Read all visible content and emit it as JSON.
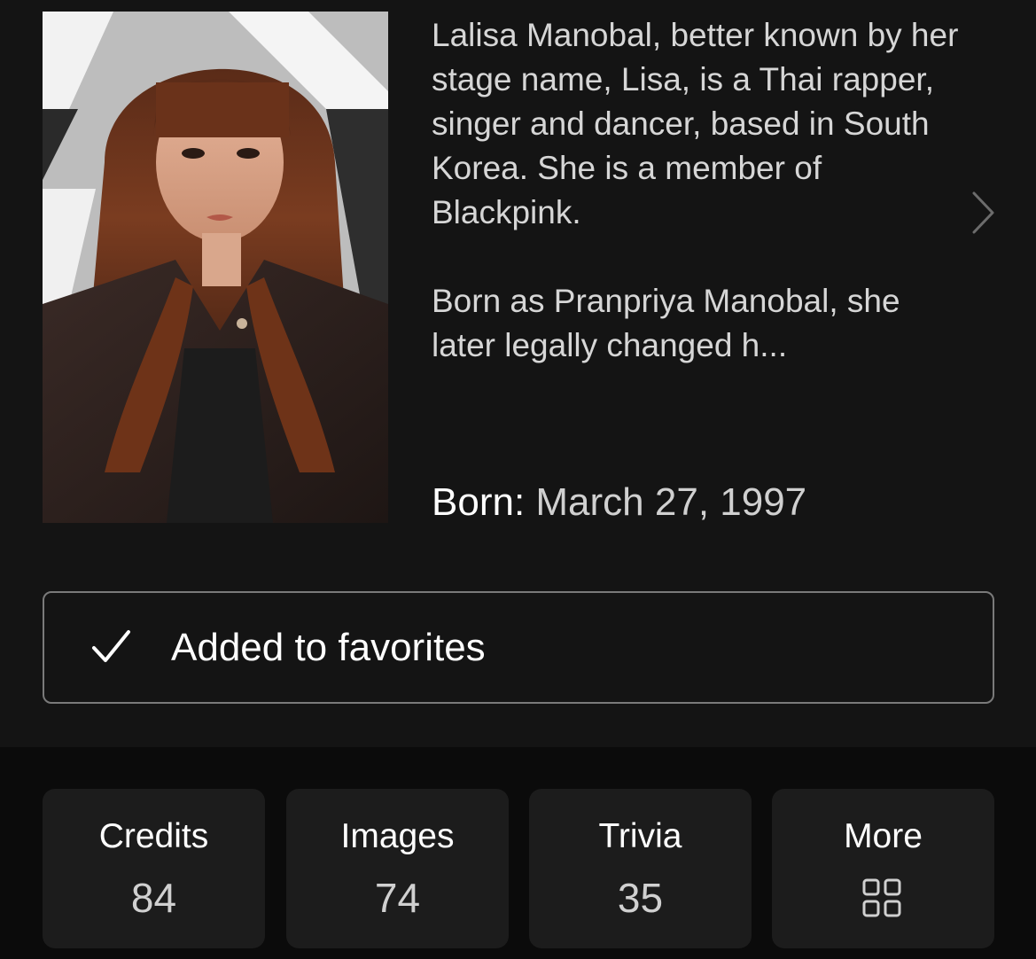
{
  "profile": {
    "bio_paragraphs": [
      "Lalisa Manobal, better known by her stage name, Lisa, is a Thai rapper, singer and dancer, based in South Korea. She is a member of Blackpink.",
      "Born as Pranpriya Manobal, she later legally changed h..."
    ],
    "born_label": "Born:",
    "born_value": "March 27, 1997"
  },
  "favorite": {
    "label": "Added to favorites"
  },
  "stats": [
    {
      "label": "Credits",
      "count": "84"
    },
    {
      "label": "Images",
      "count": "74"
    },
    {
      "label": "Trivia",
      "count": "35"
    },
    {
      "label": "More",
      "icon": "grid-icon"
    }
  ],
  "colors": {
    "background_top": "#141414",
    "background_bottom": "#0b0b0b",
    "tile": "#1c1c1c",
    "text_primary": "#ffffff",
    "text_secondary": "#d6d6d6",
    "button_border": "#7a7a7a"
  },
  "icons": {
    "expand": "chevron-right-icon",
    "favorite": "checkmark-icon",
    "more": "grid-icon"
  }
}
